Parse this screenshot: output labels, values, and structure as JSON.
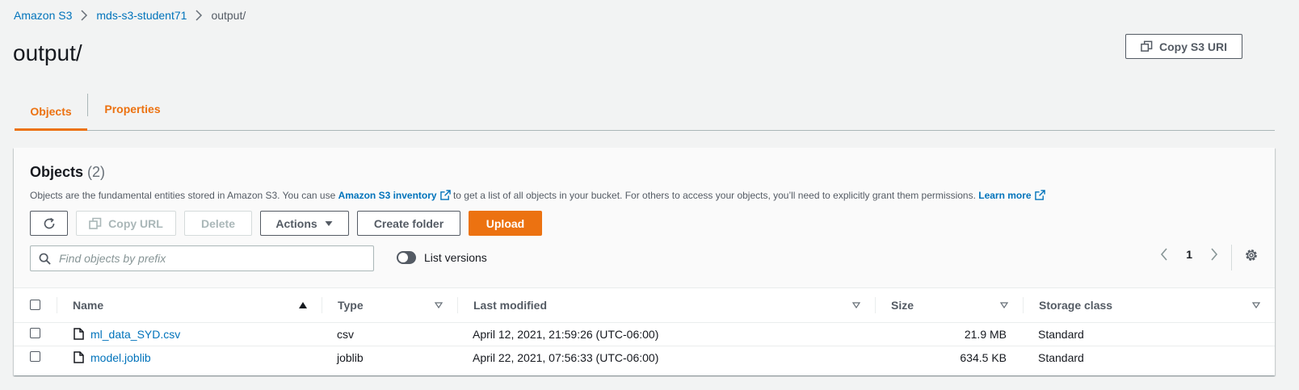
{
  "breadcrumb": {
    "items": [
      "Amazon S3",
      "mds-s3-student71"
    ],
    "current": "output/"
  },
  "page": {
    "title": "output/",
    "copy_uri_label": "Copy S3 URI"
  },
  "tabs": [
    {
      "label": "Objects",
      "active": true
    },
    {
      "label": "Properties",
      "active": false
    }
  ],
  "objects_panel": {
    "heading": "Objects",
    "count": "(2)",
    "description_pre": "Objects are the fundamental entities stored in Amazon S3. You can use ",
    "inventory_link": "Amazon S3 inventory",
    "description_mid": " to get a list of all objects in your bucket. For others to access your objects, you’ll need to explicitly grant them permissions. ",
    "learn_more": "Learn more",
    "buttons": {
      "copy_url": "Copy URL",
      "delete": "Delete",
      "actions": "Actions",
      "create_folder": "Create folder",
      "upload": "Upload"
    },
    "search_placeholder": "Find objects by prefix",
    "list_versions_label": "List versions",
    "page_number": "1"
  },
  "table": {
    "columns": [
      "Name",
      "Type",
      "Last modified",
      "Size",
      "Storage class"
    ],
    "rows": [
      {
        "name": "ml_data_SYD.csv",
        "type": "csv",
        "modified": "April 12, 2021, 21:59:26 (UTC-06:00)",
        "size": "21.9 MB",
        "storage": "Standard"
      },
      {
        "name": "model.joblib",
        "type": "joblib",
        "modified": "April 22, 2021, 07:56:33 (UTC-06:00)",
        "size": "634.5 KB",
        "storage": "Standard"
      }
    ]
  },
  "colors": {
    "accent": "#ec7211",
    "link": "#0073bb",
    "background": "#f2f3f3"
  }
}
